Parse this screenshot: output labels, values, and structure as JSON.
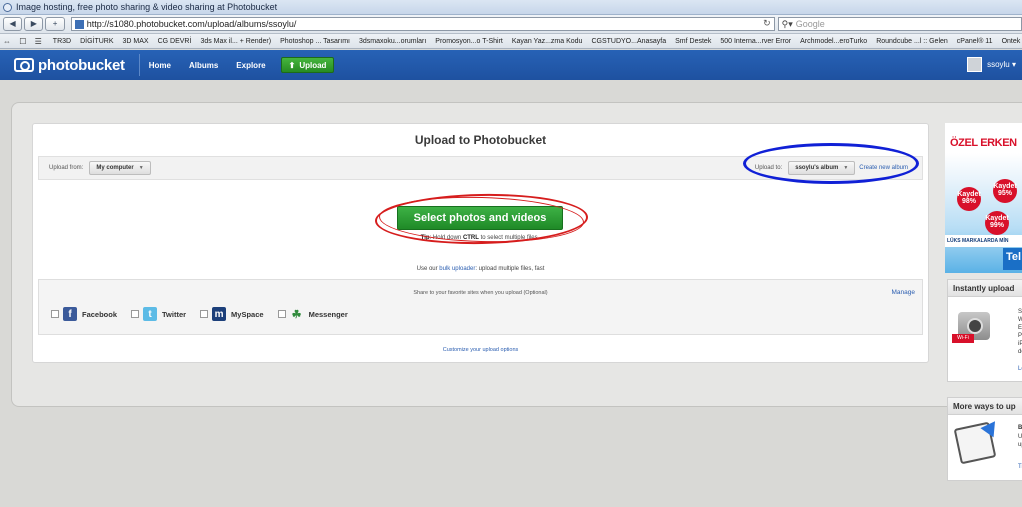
{
  "browser": {
    "window_title": "Image hosting, free photo sharing & video sharing at Photobucket",
    "nav_back": "◀",
    "nav_forward": "▶",
    "new_tab": "+",
    "url": "http://s1080.photobucket.com/upload/albums/ssoylu/",
    "search_placeholder": "Google",
    "bookmarks_bar_icons": "⇔ ☐ ☰",
    "bookmarks": [
      "TR3D",
      "DİGİTURK",
      "3D MAX",
      "CG DEVRİ",
      "3ds Max il... + Render)",
      "Photoshop ... Tasarımı",
      "3dsmaxoku...orumları",
      "Promosyon...o T-Shirt",
      "Kayan Yaz...zma Kodu",
      "CGSTUDYO...Anasayfa",
      "Smf Destek",
      "500 Interna...rver Error",
      "Archmodel...eroTurko",
      "Roundcube ...l :: Gelen",
      "cPanel® 11",
      "Ontek"
    ]
  },
  "header": {
    "logo_text": "photobucket",
    "nav": [
      "Home",
      "Albums",
      "Explore"
    ],
    "upload_button": "Upload",
    "upload_icon": "⬆",
    "username": "ssoylu ▾"
  },
  "upload": {
    "title": "Upload to Photobucket",
    "upload_from_label": "Upload from:",
    "upload_from_value": "My computer",
    "upload_to_label": "Upload to:",
    "upload_to_value": "ssoylu's album",
    "create_album_link": "Create new album",
    "select_button": "Select photos and videos",
    "tip_label": "Tip",
    "tip_text_pre": ": Hold down ",
    "tip_key": "CTRL",
    "tip_text_post": " to select multiple files.",
    "bulk_pre": "Use our ",
    "bulk_link": "bulk uploader",
    "bulk_post": ": upload multiple files, fast",
    "share_header": "Share to your favorite sites when you upload (Optional)",
    "manage_link": "Manage",
    "share_sites": [
      {
        "label": "Facebook",
        "icon": "f",
        "icon_name": "facebook-icon"
      },
      {
        "label": "Twitter",
        "icon": "t",
        "icon_name": "twitter-icon"
      },
      {
        "label": "MySpace",
        "icon": "m",
        "icon_name": "myspace-icon"
      },
      {
        "label": "Messenger",
        "icon": "☘",
        "icon_name": "messenger-icon"
      }
    ],
    "customize_link": "Customize your upload options"
  },
  "ads": {
    "banner_title": "ÖZEL ERKEN",
    "badge_1": "Kaydet 98%",
    "badge_2": "Kaydet 95%",
    "badge_3": "Kaydet 99%",
    "banner_band": "LÜKS MARKALARDA MİN",
    "banner_tel": "Tel"
  },
  "sidebar": {
    "instant_title": "Instantly upload",
    "instant_lines": [
      "Sa",
      "W",
      "E",
      "P",
      "iP",
      "de"
    ],
    "instant_icon_tag": "Wi-Fi",
    "instant_link": "Le",
    "more_title": "More ways to up",
    "more_lines": [
      "B",
      "U",
      "up"
    ],
    "more_link": "Tr"
  },
  "colors": {
    "header_blue": "#1e51a0",
    "upload_green": "#278b22",
    "select_green": "#1f8a27",
    "link_blue": "#2a5db0",
    "annotation_red": "#d61d1d",
    "annotation_blue": "#1020d6"
  }
}
